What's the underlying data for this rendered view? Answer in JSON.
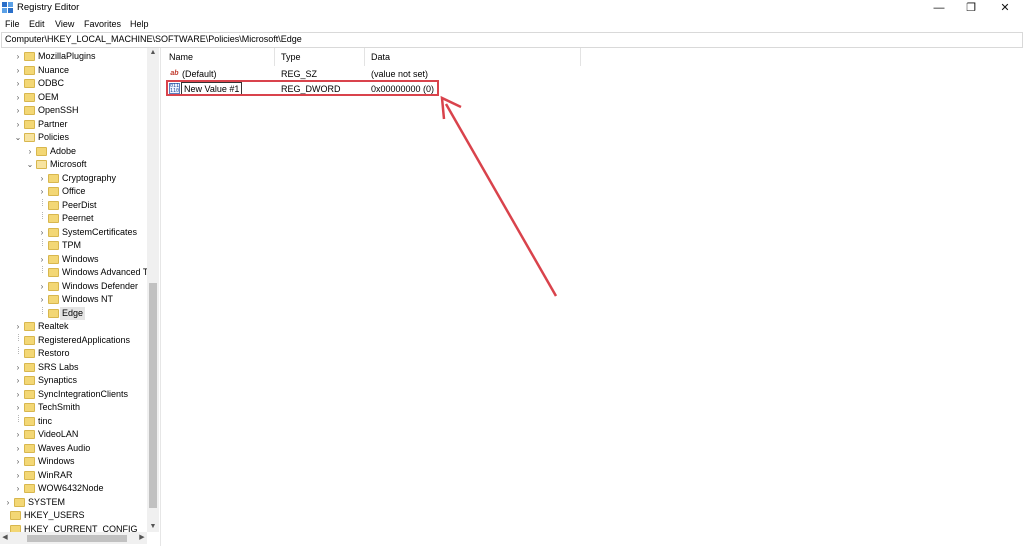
{
  "window": {
    "title": "Registry Editor",
    "minimize_glyph": "—",
    "restore_glyph": "❐",
    "close_glyph": "✕"
  },
  "menu": [
    "File",
    "Edit",
    "View",
    "Favorites",
    "Help"
  ],
  "address": "Computer\\HKEY_LOCAL_MACHINE\\SOFTWARE\\Policies\\Microsoft\\Edge",
  "tree": {
    "items": [
      {
        "label": "MozillaPlugins",
        "level": 1,
        "state": "collapsed"
      },
      {
        "label": "Nuance",
        "level": 1,
        "state": "collapsed"
      },
      {
        "label": "ODBC",
        "level": 1,
        "state": "collapsed"
      },
      {
        "label": "OEM",
        "level": 1,
        "state": "collapsed"
      },
      {
        "label": "OpenSSH",
        "level": 1,
        "state": "collapsed"
      },
      {
        "label": "Partner",
        "level": 1,
        "state": "collapsed"
      },
      {
        "label": "Policies",
        "level": 1,
        "state": "expanded"
      },
      {
        "label": "Adobe",
        "level": 2,
        "state": "collapsed"
      },
      {
        "label": "Microsoft",
        "level": 2,
        "state": "expanded"
      },
      {
        "label": "Cryptography",
        "level": 3,
        "state": "collapsed"
      },
      {
        "label": "Office",
        "level": 3,
        "state": "collapsed"
      },
      {
        "label": "PeerDist",
        "level": 3,
        "state": "leaf"
      },
      {
        "label": "Peernet",
        "level": 3,
        "state": "leaf"
      },
      {
        "label": "SystemCertificates",
        "level": 3,
        "state": "collapsed"
      },
      {
        "label": "TPM",
        "level": 3,
        "state": "leaf"
      },
      {
        "label": "Windows",
        "level": 3,
        "state": "collapsed"
      },
      {
        "label": "Windows Advanced T",
        "level": 3,
        "state": "leaf"
      },
      {
        "label": "Windows Defender",
        "level": 3,
        "state": "collapsed"
      },
      {
        "label": "Windows NT",
        "level": 3,
        "state": "collapsed"
      },
      {
        "label": "Edge",
        "level": 3,
        "state": "leaf",
        "selected": true
      },
      {
        "label": "Realtek",
        "level": 1,
        "state": "collapsed"
      },
      {
        "label": "RegisteredApplications",
        "level": 1,
        "state": "leaf"
      },
      {
        "label": "Restoro",
        "level": 1,
        "state": "leaf"
      },
      {
        "label": "SRS Labs",
        "level": 1,
        "state": "collapsed"
      },
      {
        "label": "Synaptics",
        "level": 1,
        "state": "collapsed"
      },
      {
        "label": "SyncIntegrationClients",
        "level": 1,
        "state": "collapsed"
      },
      {
        "label": "TechSmith",
        "level": 1,
        "state": "collapsed"
      },
      {
        "label": "tinc",
        "level": 1,
        "state": "leaf"
      },
      {
        "label": "VideoLAN",
        "level": 1,
        "state": "collapsed"
      },
      {
        "label": "Waves Audio",
        "level": 1,
        "state": "collapsed"
      },
      {
        "label": "Windows",
        "level": 1,
        "state": "collapsed"
      },
      {
        "label": "WinRAR",
        "level": 1,
        "state": "collapsed"
      },
      {
        "label": "WOW6432Node",
        "level": 1,
        "state": "collapsed"
      },
      {
        "label": "SYSTEM",
        "level": 0,
        "state": "collapsed"
      },
      {
        "label": "HKEY_USERS",
        "level": -1,
        "state": "collapsed"
      },
      {
        "label": "HKEY_CURRENT_CONFIG",
        "level": -1,
        "state": "collapsed"
      }
    ]
  },
  "list": {
    "columns": [
      "Name",
      "Type",
      "Data"
    ],
    "rows": [
      {
        "name": "(Default)",
        "type": "REG_SZ",
        "data": "(value not set)",
        "icon": "string-value-icon",
        "glyph": "ab"
      },
      {
        "name": "New Value #1",
        "type": "REG_DWORD",
        "data": "0x00000000 (0)",
        "icon": "binary-value-icon",
        "glyph": "011\n110",
        "renaming": true
      }
    ]
  },
  "colors": {
    "highlight": "#d9434c",
    "folder": "#f3d775"
  }
}
